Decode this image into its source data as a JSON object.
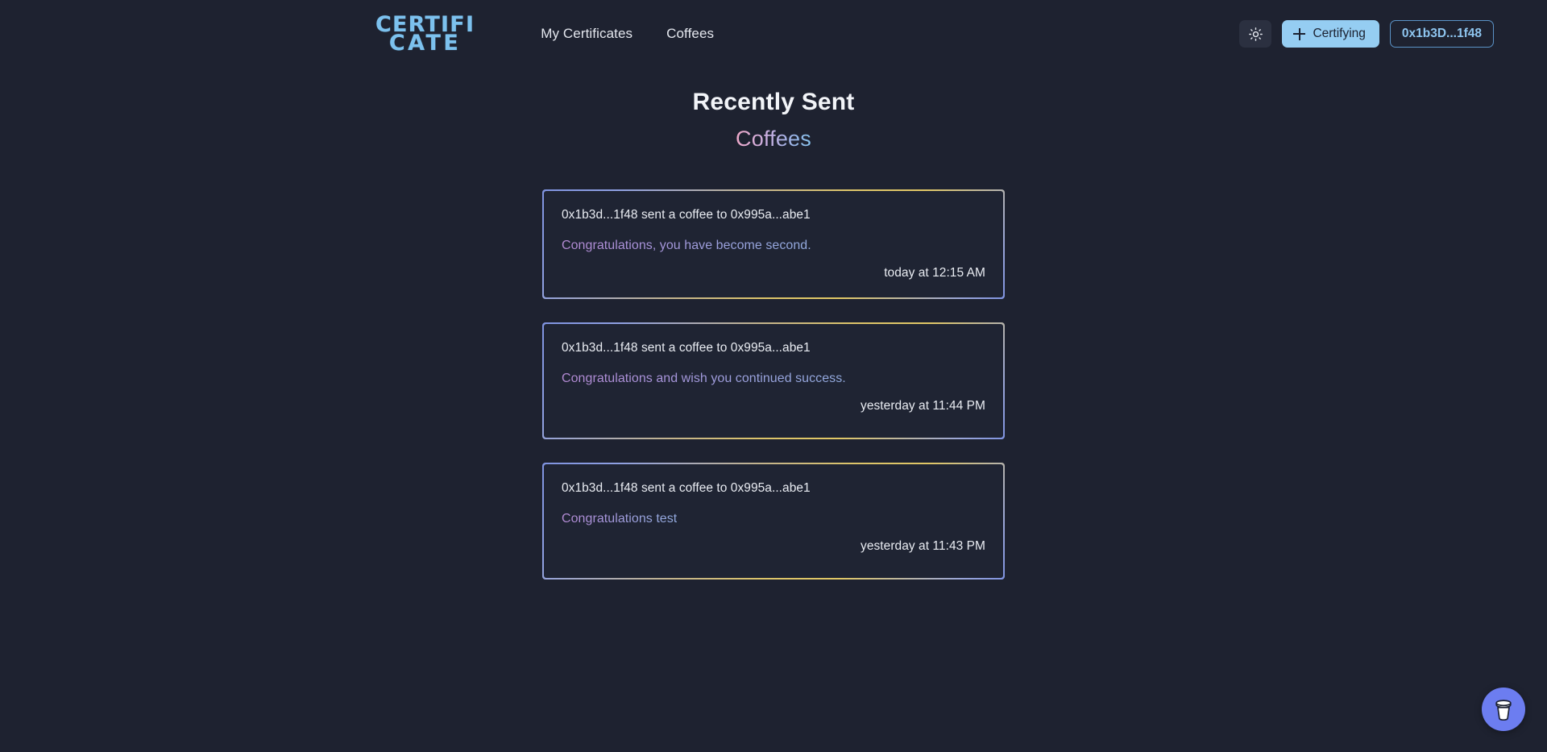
{
  "header": {
    "logo": {
      "line1": "CERTIFI",
      "line2": "CATE",
      "color": "#7cc1ee"
    },
    "nav": [
      {
        "label": "My Certificates",
        "name": "nav-my-certificates"
      },
      {
        "label": "Coffees",
        "name": "nav-coffees"
      }
    ],
    "theme_toggle": {
      "icon": "sun-icon",
      "title": "Toggle theme"
    },
    "certifying_button": {
      "label": "Certifying",
      "icon": "plus-icon",
      "bg": "#95cdf2",
      "fg": "#1b2130"
    },
    "address_badge": {
      "label": "0x1b3D...1f48",
      "border": "#5b93c7",
      "color": "#8ec5ef"
    }
  },
  "main": {
    "title": "Recently Sent",
    "subtitle": "Coffees",
    "subtitle_gradient": [
      "#efa8c8",
      "#87c4ee"
    ],
    "cards": [
      {
        "header": "0x1b3d...1f48 sent a coffee to 0x995a...abe1",
        "message": "Congratulations, you have become second.",
        "time": "today at 12:15 AM"
      },
      {
        "header": "0x1b3d...1f48 sent a coffee to 0x995a...abe1",
        "message": "Congratulations and wish you continued success.",
        "time": "yesterday at 11:44 PM"
      },
      {
        "header": "0x1b3d...1f48 sent a coffee to 0x995a...abe1",
        "message": "Congratulations test",
        "time": "yesterday at 11:43 PM"
      }
    ],
    "card_border_gradient": [
      "#7f93e0",
      "#e0c766"
    ]
  },
  "fab": {
    "icon": "coffee-cup-icon",
    "bg": "#6c7df0",
    "title": "Buy a coffee"
  },
  "theme": {
    "page_bg": "#1e2230",
    "card_bg": "#1f2433",
    "text": "#e9ecf2"
  }
}
